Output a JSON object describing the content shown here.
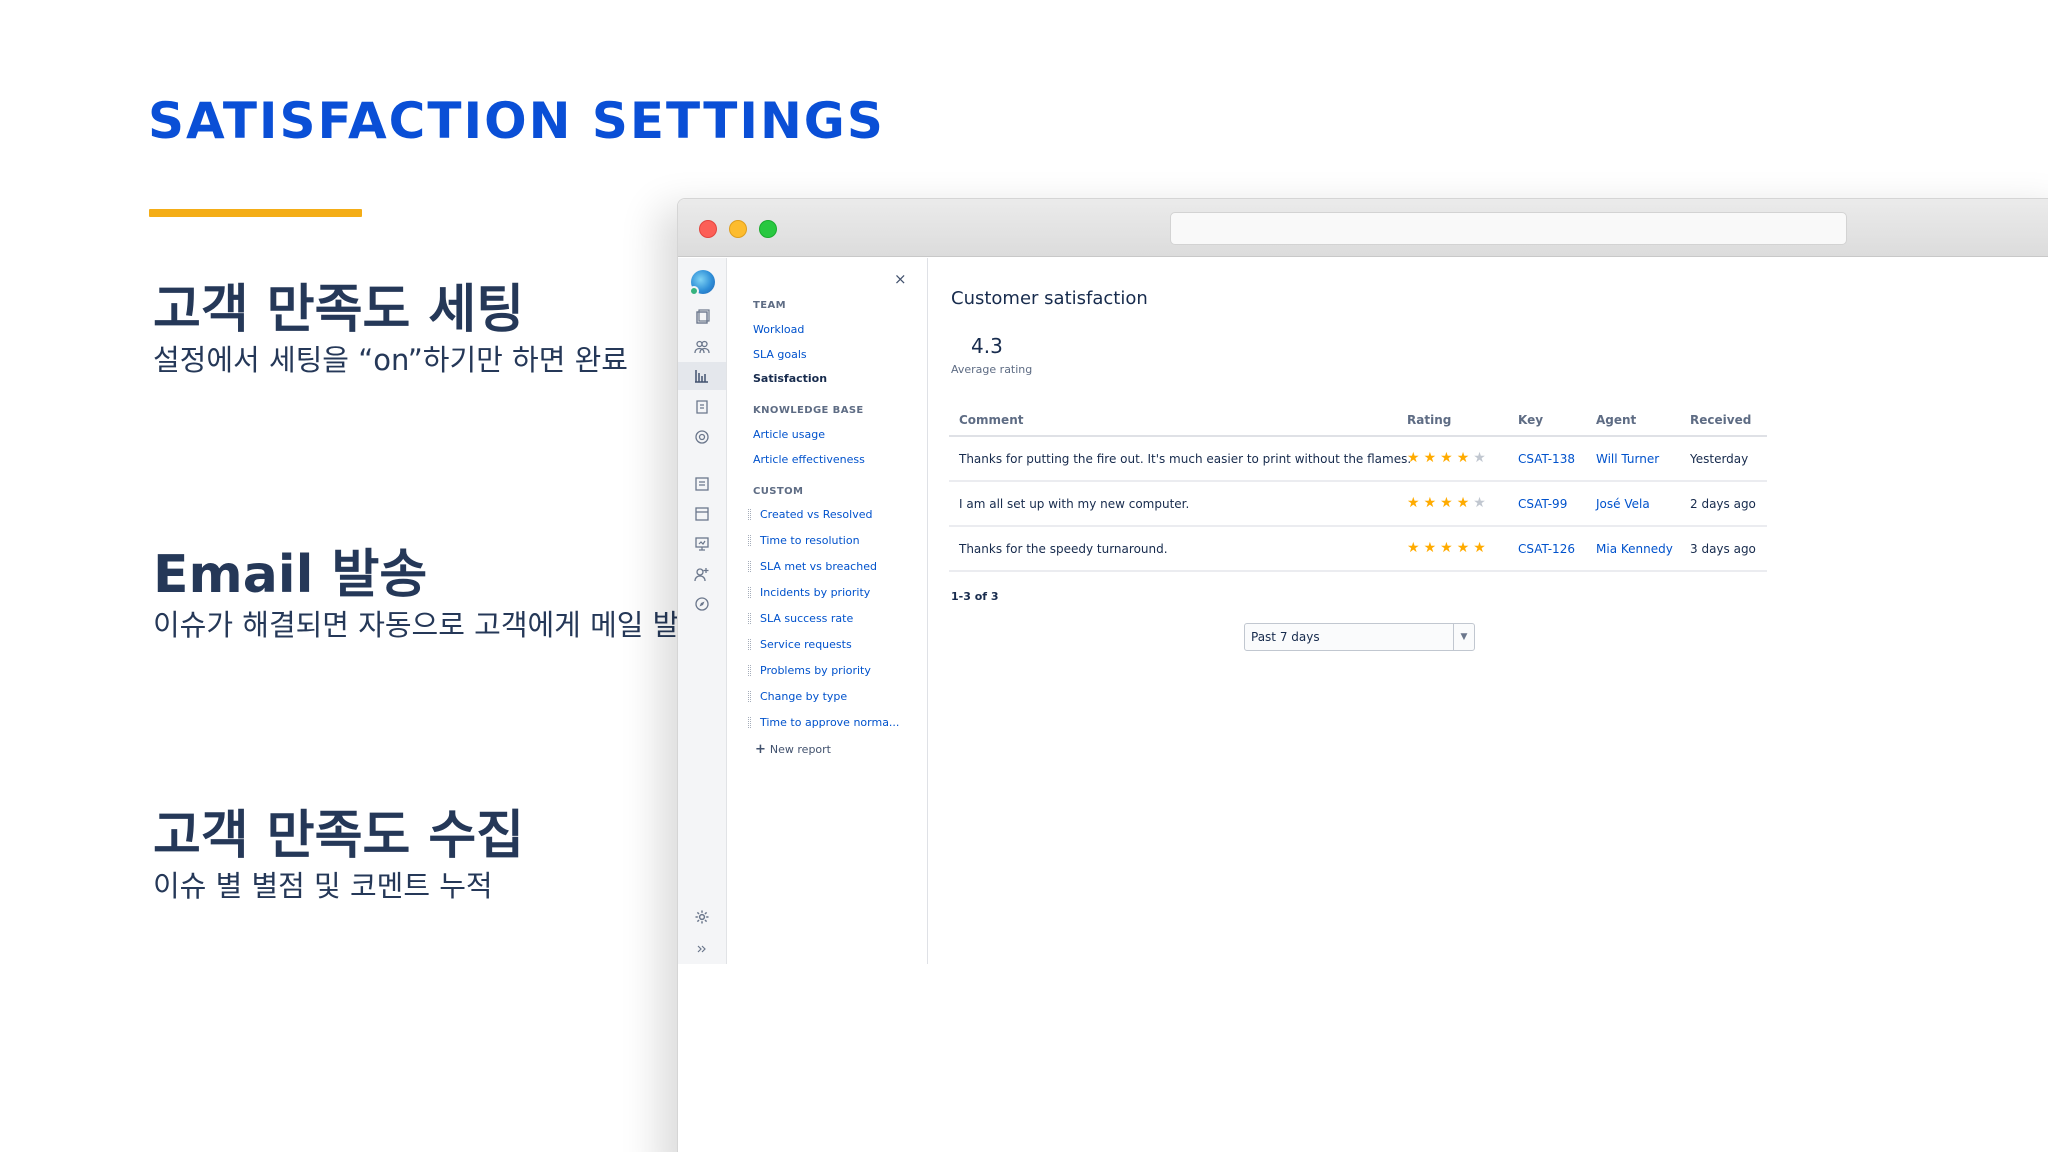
{
  "slide": {
    "title": "SATISFACTION SETTINGS",
    "features": [
      {
        "heading": "고객 만족도 세팅",
        "description": "설정에서 세팅을 “on”하기만 하면 완료"
      },
      {
        "heading": "Email 발송",
        "description": "이슈가 해결되면 자동으로 고객에게 메일 발송"
      },
      {
        "heading": "고객 만족도 수집",
        "description": "이슈 별 별점 및 코멘트 누적"
      }
    ],
    "colors": {
      "title": "#0a4fd6",
      "accent_bar": "#f4ad17",
      "text": "#253858"
    }
  },
  "browser": {
    "iconbar_icons": [
      "app-logo-icon",
      "queues-icon",
      "customers-icon",
      "reports-icon",
      "knowledge-base-icon",
      "settings-circle-icon",
      "boards-icon",
      "issues-icon",
      "monitor-icon",
      "add-people-icon",
      "compass-icon",
      "gear-icon",
      "expand-icon"
    ],
    "nav": {
      "close_label": "×",
      "sections": {
        "team": "TEAM",
        "knowledge_base": "KNOWLEDGE BASE",
        "custom": "CUSTOM"
      },
      "team_links": [
        "Workload",
        "SLA goals",
        "Satisfaction"
      ],
      "kb_links": [
        "Article usage",
        "Article effectiveness"
      ],
      "custom_links": [
        "Created vs Resolved",
        "Time to resolution",
        "SLA met vs breached",
        "Incidents by priority",
        "SLA success rate",
        "Service requests",
        "Problems by priority",
        "Change by type",
        "Time to approve norma..."
      ],
      "new_report_label": "New report"
    },
    "main": {
      "heading": "Customer satisfaction",
      "average_value": "4.3",
      "average_label": "Average rating",
      "table": {
        "headers": [
          "Comment",
          "Rating",
          "Key",
          "Agent",
          "Received"
        ],
        "rows": [
          {
            "comment": "Thanks for putting the fire out. It's much easier to print without the flames.",
            "rating": 4,
            "key": "CSAT-138",
            "agent": "Will Turner",
            "received": "Yesterday"
          },
          {
            "comment": "I am all set up with my new computer.",
            "rating": 4,
            "key": "CSAT-99",
            "agent": "José Vela",
            "received": "2 days ago"
          },
          {
            "comment": "Thanks for the speedy turnaround.",
            "rating": 5,
            "key": "CSAT-126",
            "agent": "Mia Kennedy",
            "received": "3 days ago"
          }
        ]
      },
      "pagination": "1-3 of 3",
      "period_select": "Past 7 days"
    },
    "colors": {
      "link": "#0052cc",
      "star_on": "#ffab00",
      "star_off": "#c1c7d0"
    }
  }
}
